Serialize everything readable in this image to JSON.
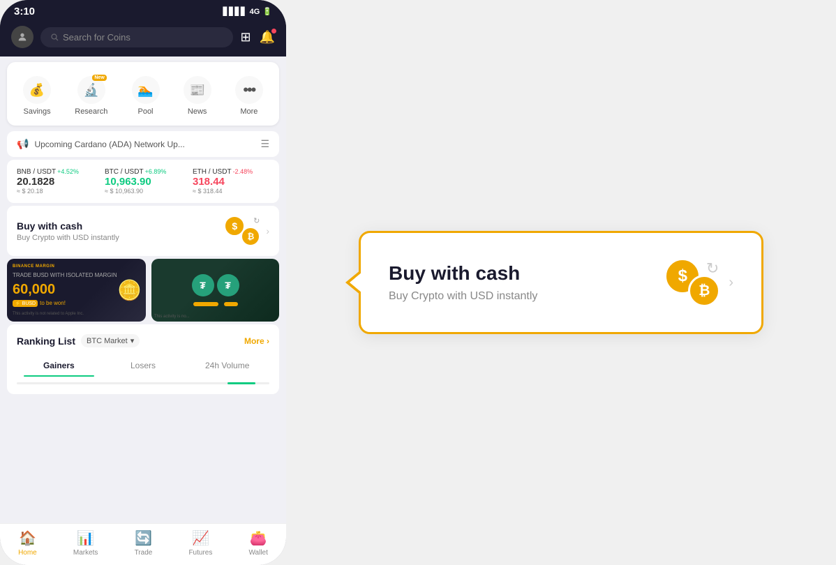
{
  "status_bar": {
    "time": "3:10",
    "signal": "▋▋▋▋",
    "network": "4G",
    "battery": "🔋"
  },
  "header": {
    "search_placeholder": "Search for Coins"
  },
  "quick_menu": {
    "items": [
      {
        "label": "Savings",
        "icon": "💰",
        "new": false
      },
      {
        "label": "Research",
        "icon": "🔬",
        "new": true
      },
      {
        "label": "Pool",
        "icon": "🏊",
        "new": false
      },
      {
        "label": "News",
        "icon": "📰",
        "new": false
      },
      {
        "label": "More",
        "icon": "⋯",
        "new": false
      }
    ]
  },
  "announcement": {
    "text": "Upcoming Cardano (ADA) Network Up..."
  },
  "tickers": [
    {
      "pair": "BNB / USDT",
      "change": "+4.52%",
      "direction": "up",
      "price": "20.1828",
      "usd": "≈ $ 20.18"
    },
    {
      "pair": "BTC / USDT",
      "change": "+6.89%",
      "direction": "up",
      "price": "10,963.90",
      "usd": "≈ $ 10,963.90"
    },
    {
      "pair": "ETH / USDT",
      "change": "-2.48%",
      "direction": "down",
      "price": "318.44",
      "usd": "≈ $ 318.44"
    }
  ],
  "buy_cash": {
    "title": "Buy with cash",
    "subtitle": "Buy Crypto with USD instantly",
    "dollar_label": "$",
    "btc_label": "₿"
  },
  "banners": [
    {
      "brand": "BINANCE MARGIN",
      "description": "TRADE BUSD WITH ISOLATED MARGIN",
      "amount": "60,000",
      "currency": "BUSD to be won!",
      "disclaimer": "This activity is not related to Apple Inc."
    },
    {
      "disclaimer": "This activity is no..."
    }
  ],
  "ranking": {
    "title": "Ranking List",
    "market": "BTC Market",
    "more_label": "More",
    "tabs": [
      "Gainers",
      "Losers",
      "24h Volume"
    ],
    "active_tab": 0
  },
  "bottom_nav": {
    "items": [
      {
        "label": "Home",
        "icon": "🏠",
        "active": true
      },
      {
        "label": "Markets",
        "icon": "📊",
        "active": false
      },
      {
        "label": "Trade",
        "icon": "🔄",
        "active": false
      },
      {
        "label": "Futures",
        "icon": "📈",
        "active": false
      },
      {
        "label": "Wallet",
        "icon": "👛",
        "active": false
      }
    ]
  },
  "buy_cash_detail": {
    "title": "Buy with cash",
    "subtitle": "Buy Crypto with USD instantly",
    "dollar_label": "$",
    "btc_label": "₿"
  }
}
